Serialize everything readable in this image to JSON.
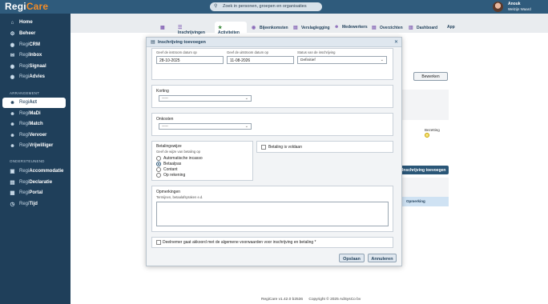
{
  "app": {
    "logo_main": "Regi",
    "logo_accent": "Care"
  },
  "search": {
    "icon": "search-icon",
    "placeholder": "Zoek in personen, groepen en organisaties"
  },
  "user": {
    "name": "Anouk",
    "role": "Welzijn Waard"
  },
  "sidebar": {
    "main": [
      {
        "icon": "home-icon",
        "prefix": "",
        "label": "Home"
      },
      {
        "icon": "gear-icon",
        "prefix": "",
        "label": "Beheer"
      },
      {
        "icon": "eye-icon",
        "prefix": "Regi",
        "label": "CRM"
      },
      {
        "icon": "inbox-icon",
        "prefix": "Regi",
        "label": "Inbox"
      },
      {
        "icon": "signal-icon",
        "prefix": "Regi",
        "label": "Signaal"
      },
      {
        "icon": "advice-icon",
        "prefix": "Regi",
        "label": "Advies"
      }
    ],
    "section1": "ARRANGEMENT",
    "arrangement": [
      {
        "icon": "people-icon",
        "prefix": "Regi",
        "label": "Act"
      },
      {
        "icon": "people-icon",
        "prefix": "Regi",
        "label": "MaDi"
      },
      {
        "icon": "people-icon",
        "prefix": "Regi",
        "label": "Match"
      },
      {
        "icon": "people-icon",
        "prefix": "Regi",
        "label": "Vervoer"
      },
      {
        "icon": "people-icon",
        "prefix": "Regi",
        "label": "Vrijwilliger"
      }
    ],
    "section2": "ONDERSTEUNEND",
    "ondersteunend": [
      {
        "icon": "building-icon",
        "prefix": "Regi",
        "label": "Accommodatie"
      },
      {
        "icon": "document-icon",
        "prefix": "Regi",
        "label": "Declaratie"
      },
      {
        "icon": "portal-icon",
        "prefix": "Regi",
        "label": "Portal"
      },
      {
        "icon": "clock-icon",
        "prefix": "Regi",
        "label": "Tijd"
      }
    ]
  },
  "tabs": [
    {
      "icon": "grid-icon",
      "label": ""
    },
    {
      "icon": "list-icon",
      "label": "Inschrijvingen"
    },
    {
      "icon": "activity-icon",
      "label": "Activiteiten"
    },
    {
      "icon": "meeting-icon",
      "label": "Bijeenkomsten"
    },
    {
      "icon": "report-icon",
      "label": "Verslaglegging"
    },
    {
      "icon": "staff-icon",
      "label": "Medewerkers"
    },
    {
      "icon": "overview-icon",
      "label": "Overzichten"
    },
    {
      "icon": "dashboard-icon",
      "label": "Dashboard"
    },
    {
      "icon": "",
      "label": "App"
    }
  ],
  "background": {
    "edit_button": "Bewerken",
    "bezetting": "Bezetting",
    "add_button": "Inschrijving toevoegen",
    "opmerking": "Opmerking"
  },
  "modal": {
    "title": "Inschrijving toevoegen",
    "start_label": "Geef de instroom datum op",
    "start_value": "28-10-2025",
    "end_label": "Geef de uitstroom datum op",
    "end_value": "11-08-2026",
    "status_label": "Status van de inschrijving",
    "status_value": "Definitief",
    "korting_label": "Korting",
    "korting_value": "-----",
    "onkosten_label": "Onkosten",
    "onkosten_value": "-----",
    "betaalwijze_label": "Betalingswijze",
    "betaalwijze_sub": "Geef de wijze van betaling op",
    "betaalwijze_options": [
      "Automatische incasso",
      "Betaalpas",
      "Contant",
      "Op rekening"
    ],
    "betaalwijze_selected": 1,
    "betaling_voldaan": "Betaling is voldaan",
    "opmerkingen_label": "Opmerkingen",
    "opmerkingen_sub": "Termijnen, betaalafspraken e.d.",
    "akkoord_label": "Deelnemer gaat akkoord met de algemene voorwaarden voor inschrijving en betaling *",
    "save_button": "Opslaan",
    "cancel_button": "Annuleren"
  },
  "footer": {
    "version": "RegiCare v1.42.0 b2536",
    "copyright": "Copyright © 2025 AdSysCo bv"
  }
}
